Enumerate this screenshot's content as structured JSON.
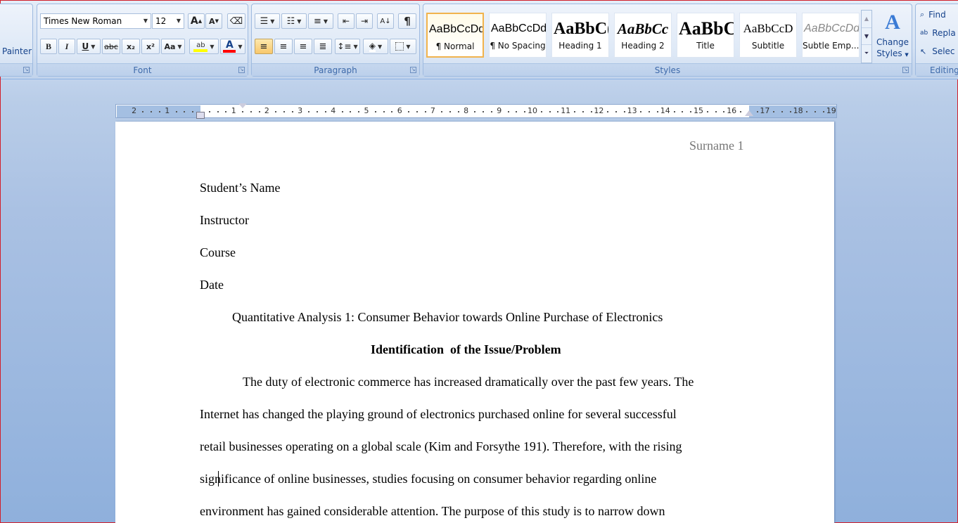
{
  "ribbon": {
    "clipboard": {
      "painter_label": "Painter"
    },
    "font": {
      "group_label": "Font",
      "font_name": "Times New Roman",
      "font_size": "12",
      "grow_label": "A",
      "shrink_label": "A",
      "bold_label": "B",
      "italic_label": "I",
      "underline_label": "U",
      "strike_label": "abc",
      "subscript_label": "x₂",
      "superscript_label": "x²",
      "case_label": "Aa",
      "highlight_label": "ab",
      "font_color_label": "A",
      "highlight_color": "#ffff00",
      "font_color": "#ff0000"
    },
    "paragraph": {
      "group_label": "Paragraph",
      "pilcrow": "¶"
    },
    "styles": {
      "group_label": "Styles",
      "items": [
        {
          "preview": "AaBbCcDd",
          "name": "¶ Normal"
        },
        {
          "preview": "AaBbCcDd",
          "name": "¶ No Spacing"
        },
        {
          "preview": "AaBbC(",
          "name": "Heading 1"
        },
        {
          "preview": "AaBbCc",
          "name": "Heading 2"
        },
        {
          "preview": "AaBbC(",
          "name": "Title"
        },
        {
          "preview": "AaBbCcD",
          "name": "Subtitle"
        },
        {
          "preview": "AaBbCcDd",
          "name": "Subtle Emp..."
        }
      ],
      "change_styles_line1": "Change",
      "change_styles_line2": "Styles"
    },
    "editing": {
      "group_label": "Editing",
      "find_label": "Find",
      "replace_label": "Repla",
      "select_label": "Selec"
    }
  },
  "ruler": {
    "left_numbers": [
      "2",
      "1"
    ],
    "right_numbers": [
      "1",
      "2",
      "3",
      "4",
      "5",
      "6",
      "7",
      "8",
      "9",
      "10",
      "11",
      "12",
      "13",
      "14",
      "15",
      "16",
      "17",
      "18",
      "19"
    ]
  },
  "document": {
    "header": "Surname 1",
    "student": "Student’s Name",
    "instructor": "Instructor",
    "course": "Course",
    "date": "Date",
    "title": "Quantitative Analysis 1: Consumer Behavior towards Online Purchase of Electronics",
    "heading": "Identification  of the Issue/Problem",
    "lines": [
      "The duty of electronic commerce has increased dramatically over the past few years. The",
      "Internet has changed the playing ground of electronics purchased online for several successful",
      "retail businesses operating on a global scale (Kim and Forsythe 191). Therefore, with the rising",
      "significance of online businesses, studies focusing on consumer behavior regarding online",
      "environment has gained considerable attention. The purpose of this study is to narrow down"
    ]
  },
  "colors": {
    "accent": "#15428b",
    "frame_border": "#d21f2a",
    "style_selected": "#f1b34d"
  }
}
